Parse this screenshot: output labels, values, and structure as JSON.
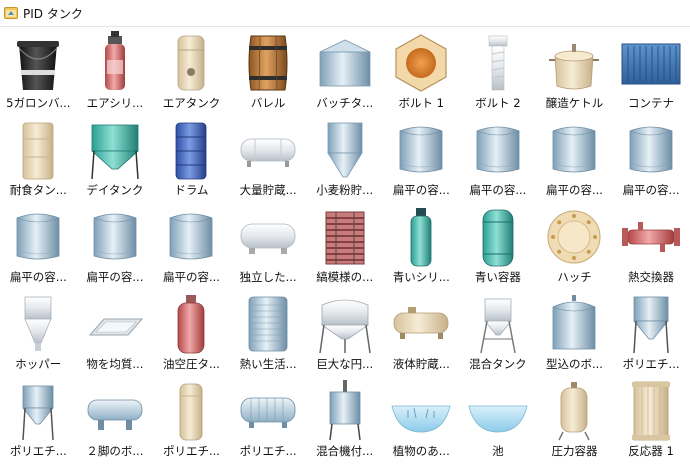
{
  "panel": {
    "title": "PID タンク",
    "icon": "library-icon"
  },
  "items": [
    {
      "label": "5ガロンバ...",
      "icon": "bucket-icon"
    },
    {
      "label": "エアシリ...",
      "icon": "air-cylinder-icon"
    },
    {
      "label": "エアタンク",
      "icon": "air-tank-icon"
    },
    {
      "label": "バレル",
      "icon": "barrel-icon"
    },
    {
      "label": "バッチタ...",
      "icon": "batch-tank-icon"
    },
    {
      "label": "ボルト 1",
      "icon": "bolt-1-icon"
    },
    {
      "label": "ボルト 2",
      "icon": "bolt-2-icon"
    },
    {
      "label": "醸造ケトル",
      "icon": "brew-kettle-icon"
    },
    {
      "label": "コンテナ",
      "icon": "container-icon"
    },
    {
      "label": "耐食タン...",
      "icon": "corrosion-resistant-tank-icon"
    },
    {
      "label": "デイタンク",
      "icon": "day-tank-icon"
    },
    {
      "label": "ドラム",
      "icon": "drum-icon"
    },
    {
      "label": "大量貯蔵...",
      "icon": "bulk-storage-icon"
    },
    {
      "label": "小麦粉貯...",
      "icon": "flour-storage-icon"
    },
    {
      "label": "扁平の容...",
      "icon": "flat-vessel-icon"
    },
    {
      "label": "扁平の容...",
      "icon": "flat-vessel-icon"
    },
    {
      "label": "扁平の容...",
      "icon": "flat-vessel-icon"
    },
    {
      "label": "扁平の容...",
      "icon": "flat-vessel-icon"
    },
    {
      "label": "扁平の容...",
      "icon": "flat-vessel-icon"
    },
    {
      "label": "扁平の容...",
      "icon": "flat-vessel-icon"
    },
    {
      "label": "扁平の容...",
      "icon": "flat-vessel-icon"
    },
    {
      "label": "独立した...",
      "icon": "standalone-tank-icon"
    },
    {
      "label": "縞模様の...",
      "icon": "striped-tank-icon"
    },
    {
      "label": "青いシリ...",
      "icon": "blue-cylinder-icon"
    },
    {
      "label": "青い容器",
      "icon": "blue-vessel-icon"
    },
    {
      "label": "ハッチ",
      "icon": "hatch-icon"
    },
    {
      "label": "熱交換器",
      "icon": "heat-exchanger-icon"
    },
    {
      "label": "ホッパー",
      "icon": "hopper-icon"
    },
    {
      "label": "物を均質...",
      "icon": "tray-icon"
    },
    {
      "label": "油空圧タ...",
      "icon": "hydraulic-tank-icon"
    },
    {
      "label": "熱い生活...",
      "icon": "hot-water-tank-icon"
    },
    {
      "label": "巨大な円...",
      "icon": "large-cone-tank-icon"
    },
    {
      "label": "液体貯蔵...",
      "icon": "liquid-storage-icon"
    },
    {
      "label": "混合タンク",
      "icon": "mixing-tank-icon"
    },
    {
      "label": "型込のボ...",
      "icon": "molded-vessel-icon"
    },
    {
      "label": "ポリエチ...",
      "icon": "poly-tank-icon"
    },
    {
      "label": "ポリエチ...",
      "icon": "poly-hopper-icon"
    },
    {
      "label": "２脚のボ...",
      "icon": "two-leg-vessel-icon"
    },
    {
      "label": "ポリエチ...",
      "icon": "poly-cylinder-icon"
    },
    {
      "label": "ポリエチ...",
      "icon": "poly-horizontal-icon"
    },
    {
      "label": "混合機付...",
      "icon": "mixer-tank-icon"
    },
    {
      "label": "植物のあ...",
      "icon": "pond-plants-icon"
    },
    {
      "label": "池",
      "icon": "pond-icon"
    },
    {
      "label": "圧力容器",
      "icon": "pressure-vessel-icon"
    },
    {
      "label": "反応器 1",
      "icon": "reactor-icon"
    }
  ]
}
